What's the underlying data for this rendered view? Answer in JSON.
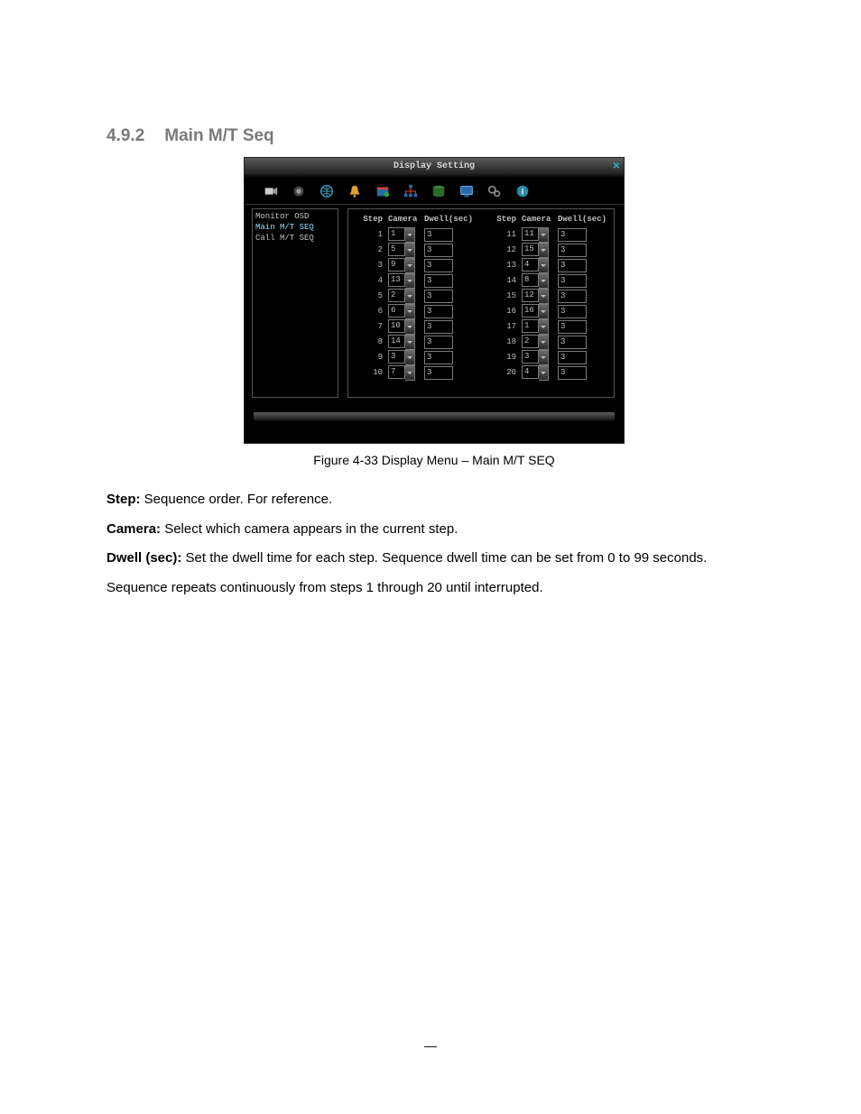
{
  "heading": {
    "number": "4.9.2",
    "title": "Main M/T Seq"
  },
  "dialog": {
    "title": "Display Setting",
    "sidebar": {
      "items": [
        {
          "label": "Monitor OSD",
          "selected": false
        },
        {
          "label": "Main M/T SEQ",
          "selected": true
        },
        {
          "label": "Call M/T SEQ",
          "selected": false
        }
      ]
    },
    "headers": {
      "step": "Step",
      "camera": "Camera",
      "dwell": "Dwell(sec)"
    },
    "rows": [
      {
        "step": "1",
        "camera": "1",
        "dwell": "3"
      },
      {
        "step": "2",
        "camera": "5",
        "dwell": "3"
      },
      {
        "step": "3",
        "camera": "9",
        "dwell": "3"
      },
      {
        "step": "4",
        "camera": "13",
        "dwell": "3"
      },
      {
        "step": "5",
        "camera": "2",
        "dwell": "3"
      },
      {
        "step": "6",
        "camera": "6",
        "dwell": "3"
      },
      {
        "step": "7",
        "camera": "10",
        "dwell": "3"
      },
      {
        "step": "8",
        "camera": "14",
        "dwell": "3"
      },
      {
        "step": "9",
        "camera": "3",
        "dwell": "3"
      },
      {
        "step": "10",
        "camera": "7",
        "dwell": "3"
      },
      {
        "step": "11",
        "camera": "11",
        "dwell": "3"
      },
      {
        "step": "12",
        "camera": "15",
        "dwell": "3"
      },
      {
        "step": "13",
        "camera": "4",
        "dwell": "3"
      },
      {
        "step": "14",
        "camera": "8",
        "dwell": "3"
      },
      {
        "step": "15",
        "camera": "12",
        "dwell": "3"
      },
      {
        "step": "16",
        "camera": "16",
        "dwell": "3"
      },
      {
        "step": "17",
        "camera": "1",
        "dwell": "3"
      },
      {
        "step": "18",
        "camera": "2",
        "dwell": "3"
      },
      {
        "step": "19",
        "camera": "3",
        "dwell": "3"
      },
      {
        "step": "20",
        "camera": "4",
        "dwell": "3"
      }
    ]
  },
  "caption": "Figure 4-33  Display Menu – Main M/T SEQ",
  "descriptions": {
    "step_label": "Step:",
    "step_text": " Sequence order. For reference.",
    "camera_label": "Camera:",
    "camera_text": " Select which camera appears in the current step.",
    "dwell_label": "Dwell (sec):",
    "dwell_text": " Set the dwell time for each step. Sequence dwell time can be set from 0 to 99 seconds.",
    "note": "Sequence repeats continuously from steps 1 through 20 until interrupted."
  },
  "page_marker": "—"
}
